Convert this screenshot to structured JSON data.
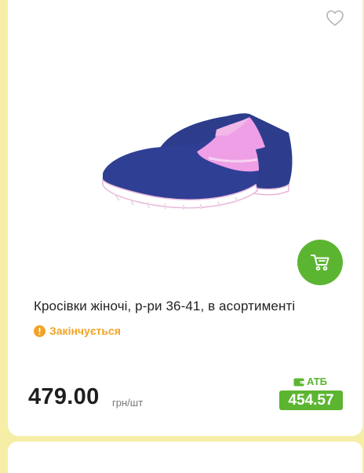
{
  "product": {
    "title": "Кросівки жіночі, р-ри 36-41, в асортименті",
    "image_icon": "sneakers-image",
    "status": {
      "text": "Закінчується",
      "icon": "warning-icon",
      "color": "#f0a325"
    },
    "price": "479.00",
    "unit": "грн/шт",
    "promo": {
      "label": "АТБ",
      "icon": "wallet-icon",
      "price": "454.57",
      "color": "#5cb531"
    }
  },
  "actions": {
    "favorite_icon": "heart-icon",
    "cart_icon": "cart-icon",
    "cart_color": "#5cb531"
  },
  "page_background": "#f6eea6"
}
